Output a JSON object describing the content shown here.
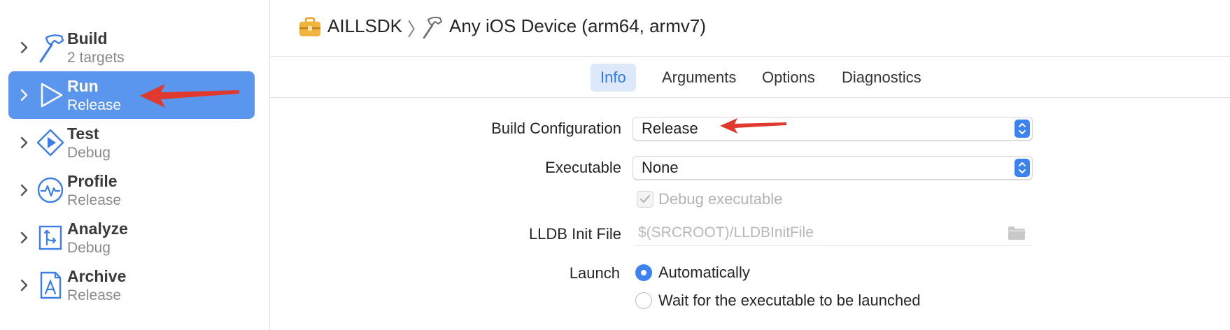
{
  "colors": {
    "selection": "#5a96ee",
    "accent": "#3c82f0",
    "annotation_arrow": "#e03a2e"
  },
  "sidebar": {
    "items": [
      {
        "title": "Build",
        "subtitle": "2 targets",
        "icon": "hammer-icon",
        "selected": false
      },
      {
        "title": "Run",
        "subtitle": "Release",
        "icon": "play-icon",
        "selected": true
      },
      {
        "title": "Test",
        "subtitle": "Debug",
        "icon": "test-diamond-icon",
        "selected": false
      },
      {
        "title": "Profile",
        "subtitle": "Release",
        "icon": "profile-waveform-icon",
        "selected": false
      },
      {
        "title": "Analyze",
        "subtitle": "Debug",
        "icon": "analyze-icon",
        "selected": false
      },
      {
        "title": "Archive",
        "subtitle": "Release",
        "icon": "archive-app-icon",
        "selected": false
      }
    ]
  },
  "path_bar": {
    "project": "AILLSDK",
    "separator": "〉",
    "destination": "Any iOS Device (arm64, armv7)"
  },
  "tabs": [
    {
      "label": "Info",
      "active": true
    },
    {
      "label": "Arguments",
      "active": false
    },
    {
      "label": "Options",
      "active": false
    },
    {
      "label": "Diagnostics",
      "active": false
    }
  ],
  "form": {
    "build_configuration": {
      "label": "Build Configuration",
      "value": "Release"
    },
    "executable": {
      "label": "Executable",
      "value": "None"
    },
    "debug_executable": {
      "label": "Debug executable",
      "checked": true,
      "enabled": false
    },
    "lldb_init_file": {
      "label": "LLDB Init File",
      "placeholder": "$(SRCROOT)/LLDBInitFile"
    },
    "launch": {
      "label": "Launch",
      "options": [
        {
          "label": "Automatically",
          "selected": true
        },
        {
          "label": "Wait for the executable to be launched",
          "selected": false
        }
      ]
    }
  }
}
